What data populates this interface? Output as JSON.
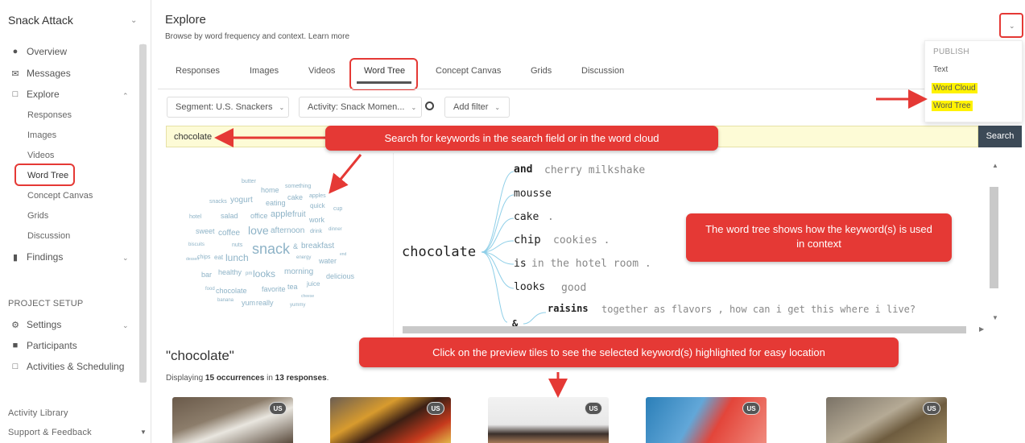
{
  "colors": {
    "accent_red": "#e53935",
    "search_bg": "#fdfbd6",
    "search_btn": "#3c4a57",
    "cloud_word": "#8eb3c7",
    "highlight_yellow": "#fff200"
  },
  "sidebar": {
    "project": "Snack Attack",
    "items": [
      {
        "label": "Overview",
        "icon": "overview-icon"
      },
      {
        "label": "Messages",
        "icon": "envelope-icon"
      },
      {
        "label": "Explore",
        "icon": "explore-icon"
      },
      {
        "label": "Findings",
        "icon": "bar-chart-icon"
      }
    ],
    "explore_sub": [
      "Responses",
      "Images",
      "Videos",
      "Word Tree",
      "Concept Canvas",
      "Grids",
      "Discussion"
    ],
    "project_setup": "PROJECT SETUP",
    "setup_items": [
      {
        "label": "Settings",
        "icon": "gear-icon"
      },
      {
        "label": "Participants",
        "icon": "person-icon"
      },
      {
        "label": "Activities & Scheduling",
        "icon": "copy-icon"
      }
    ],
    "bottom": [
      "Activity Library",
      "Support & Feedback"
    ]
  },
  "header": {
    "title": "Explore",
    "subtitle": "Browse by word frequency and context. Learn more"
  },
  "tabs": [
    "Responses",
    "Images",
    "Videos",
    "Word Tree",
    "Concept Canvas",
    "Grids",
    "Discussion"
  ],
  "filters": {
    "segment": "Segment: U.S. Snackers",
    "activity": "Activity: Snack Momen...",
    "add": "Add filter"
  },
  "search": {
    "value": "chocolate",
    "button": "Search"
  },
  "publish": {
    "header": "PUBLISH",
    "items": [
      "Text",
      "Word Cloud",
      "Word Tree"
    ]
  },
  "cloud_words": [
    "butter",
    "home",
    "something",
    "snacks",
    "yogurt",
    "eating",
    "cake",
    "apples",
    "quick",
    "cup",
    "hotel",
    "salad",
    "office",
    "apple",
    "fruit",
    "work",
    "sweet",
    "coffee",
    "love",
    "afternoon",
    "drink",
    "dinner",
    "biscuits",
    "nuts",
    "snack",
    "&",
    "breakfast",
    "dessert",
    "chips",
    "eat",
    "lunch",
    "energy",
    "water",
    "end",
    "bar",
    "healthy",
    "pm",
    "looks",
    "morning",
    "delicious",
    "food",
    "chocolate",
    "favorite",
    "tea",
    "juice",
    "banana",
    "yum",
    "really",
    "cheese",
    "yummy"
  ],
  "tree": {
    "root": "chocolate",
    "branches": [
      {
        "word": "and",
        "rest": "cherry milkshake"
      },
      {
        "word": "mousse",
        "rest": ""
      },
      {
        "word": "cake",
        "rest": "."
      },
      {
        "word": "chip",
        "rest": "cookies ."
      },
      {
        "word": "is",
        "rest": "in the hotel room ."
      },
      {
        "word": "looks",
        "rest": "good"
      },
      {
        "word": "&",
        "sub_word": "raisins",
        "rest": "together as flavors , how can i get this where i live?"
      }
    ]
  },
  "results": {
    "title": "\"chocolate\"",
    "prefix": "Displaying",
    "occ": "15 occurrences",
    "mid": "in",
    "resp": "13 responses",
    "suffix": ".",
    "badge": "US"
  },
  "callouts": {
    "search": "Search for keywords in the search field or in the word cloud",
    "tree": "The word tree shows how the keyword(s) is used in context",
    "tiles": "Click on the preview tiles to see the selected keyword(s) highlighted for easy location"
  }
}
